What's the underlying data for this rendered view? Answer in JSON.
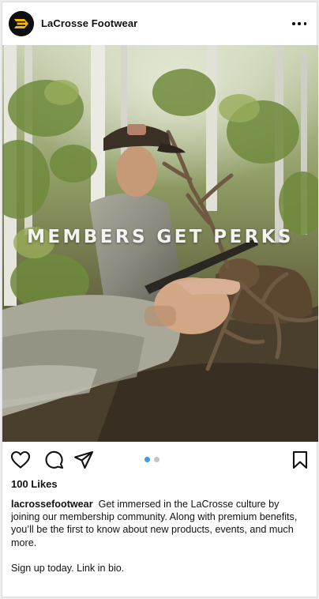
{
  "post": {
    "account_name": "LaCrosse Footwear",
    "avatar_icon": "lacrosse-logo-icon",
    "more_icon": "more-options-icon",
    "image_overlay_text": "MEMBERS GET PERKS",
    "likes": "100 Likes",
    "caption_username": "lacrossefootwear",
    "caption_text": "Get immersed in the LaCrosse culture by joining our membership community. Along with premium benefits, you’ll be the first to know about new products, events, and much more.",
    "caption_followup": "Sign up today. Link in bio.",
    "carousel": {
      "count": 2,
      "active_index": 0
    },
    "actions": [
      "like-icon",
      "comment-icon",
      "share-icon",
      "save-icon"
    ]
  },
  "colors": {
    "brand_gold": "#f2b705",
    "carousel_active": "#3d9ae8",
    "carousel_inactive": "#c4c4c4",
    "text": "#111111"
  }
}
